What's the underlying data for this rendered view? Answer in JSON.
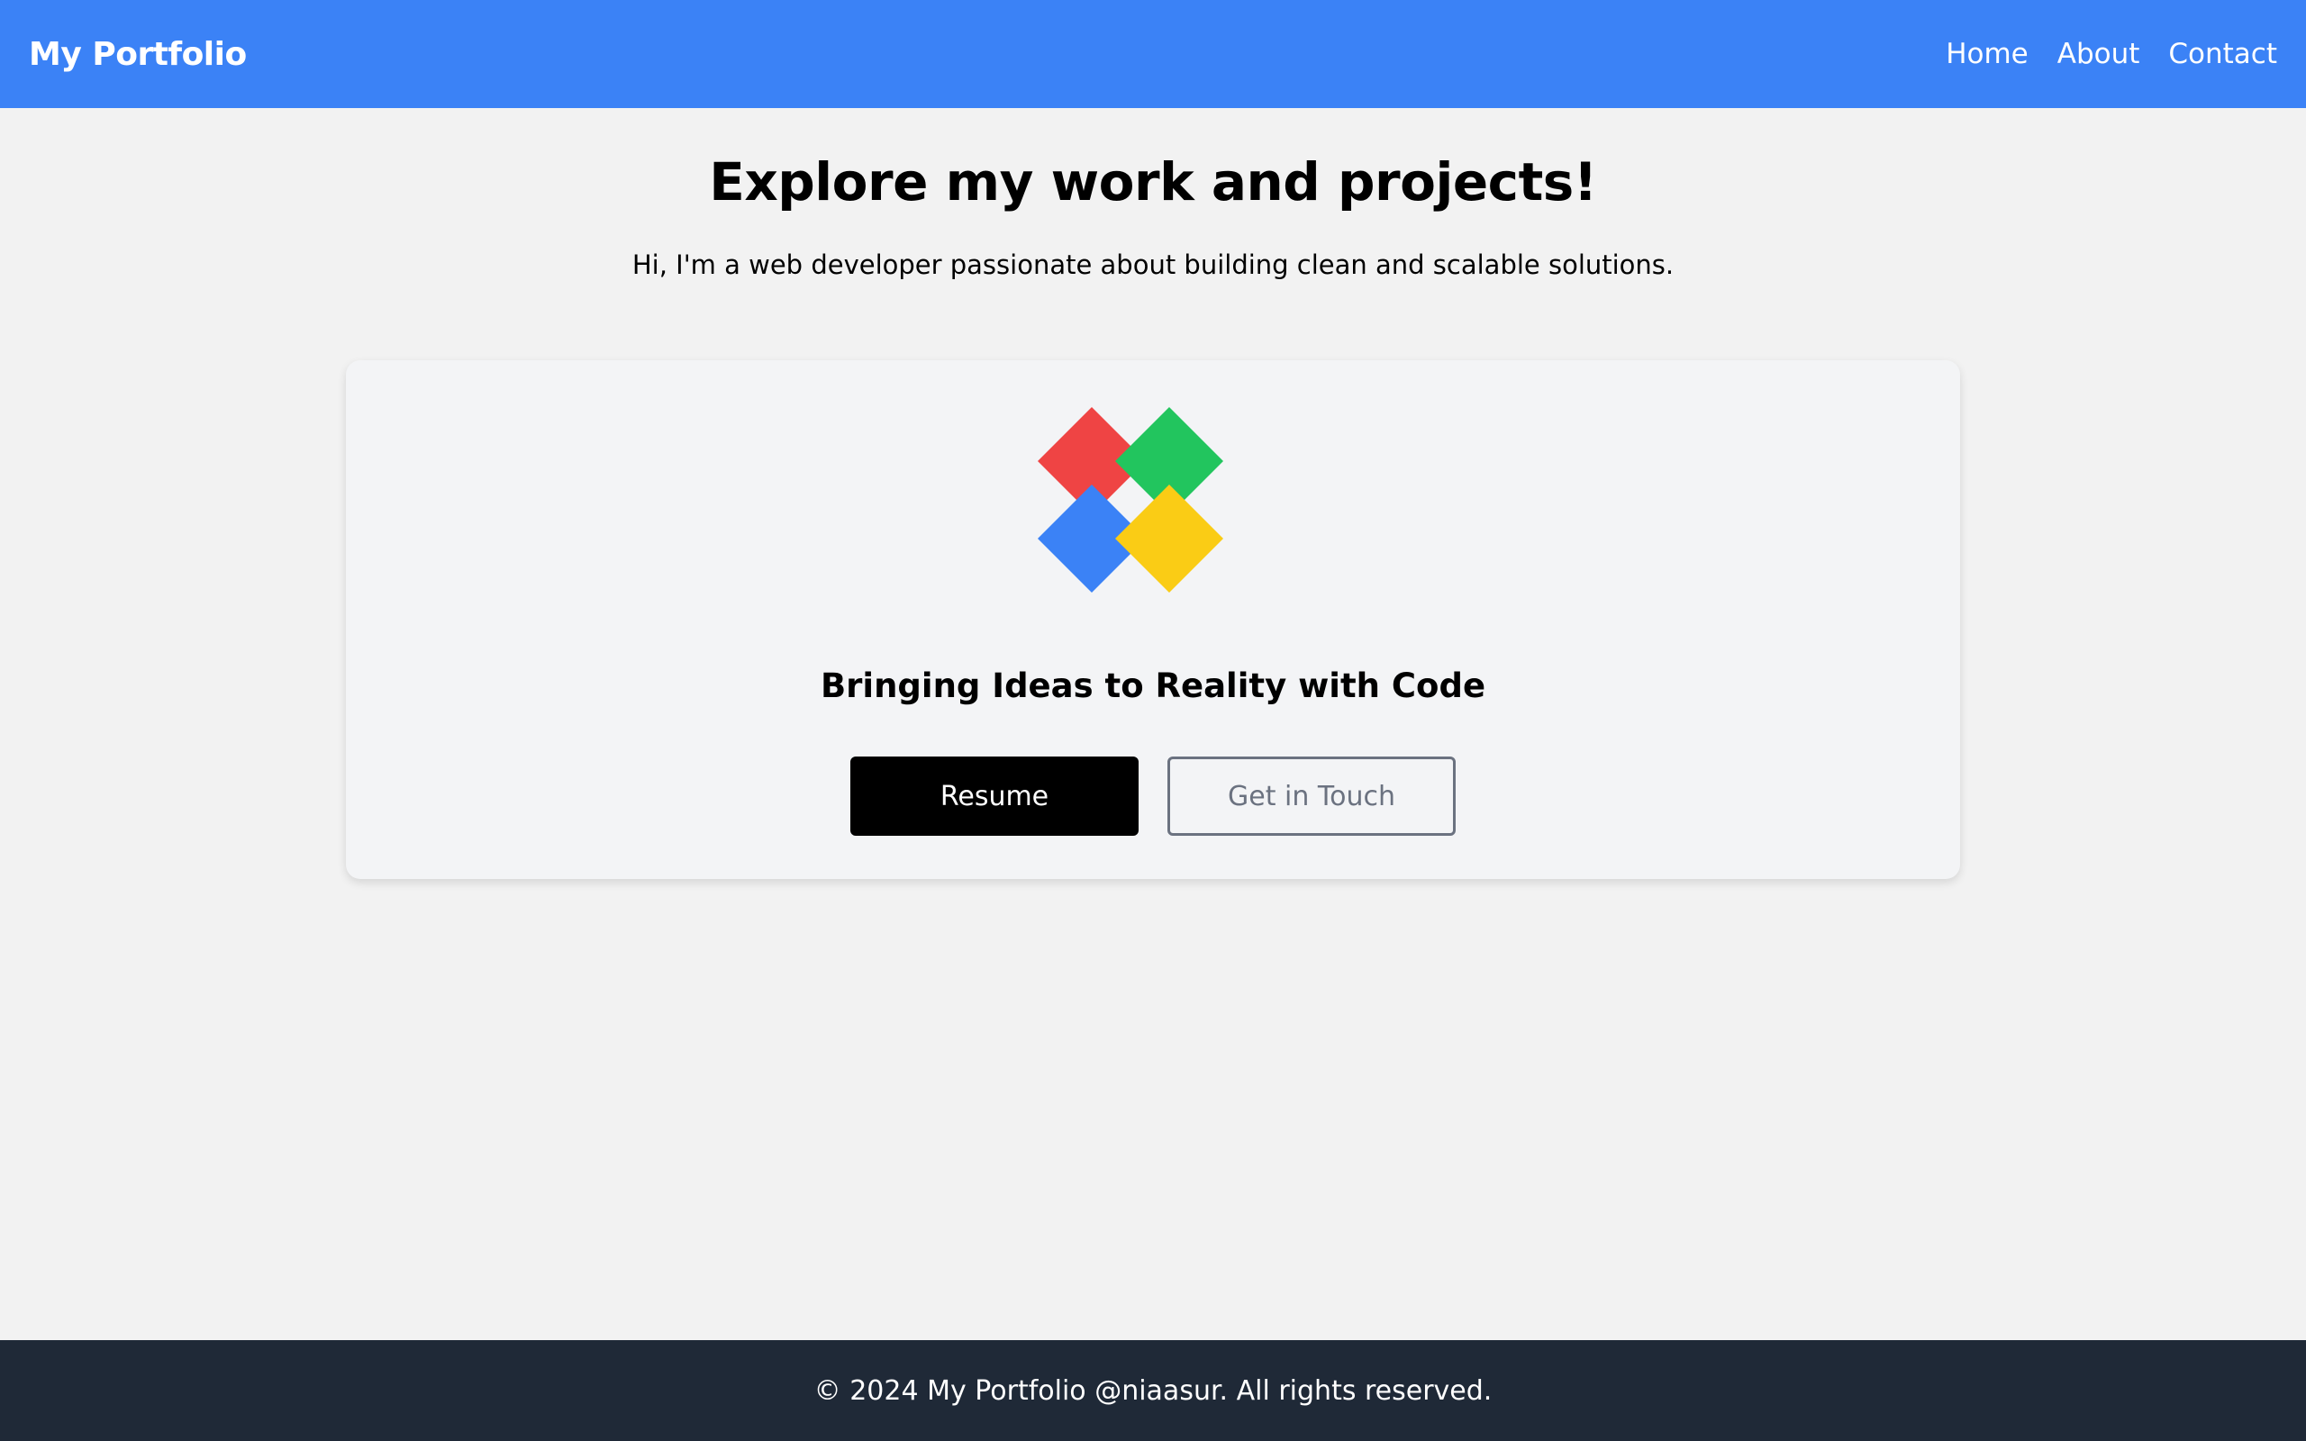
{
  "navbar": {
    "brand": "My Portfolio",
    "links": [
      "Home",
      "About",
      "Contact"
    ],
    "background": "#3b82f6"
  },
  "hero": {
    "title": "Explore my work and projects!",
    "subtitle": "Hi, I'm a web developer passionate about building clean and scalable solutions."
  },
  "card": {
    "logo": {
      "icon": "four-diamonds-logo",
      "colors": [
        "#ef4444",
        "#22c55e",
        "#3b82f6",
        "#facc15"
      ]
    },
    "title": "Bringing Ideas to Reality with Code",
    "primary_button": "Resume",
    "secondary_button": "Get in Touch"
  },
  "footer": {
    "text": "© 2024 My Portfolio @niaasur. All rights reserved.",
    "background": "#1f2937"
  }
}
